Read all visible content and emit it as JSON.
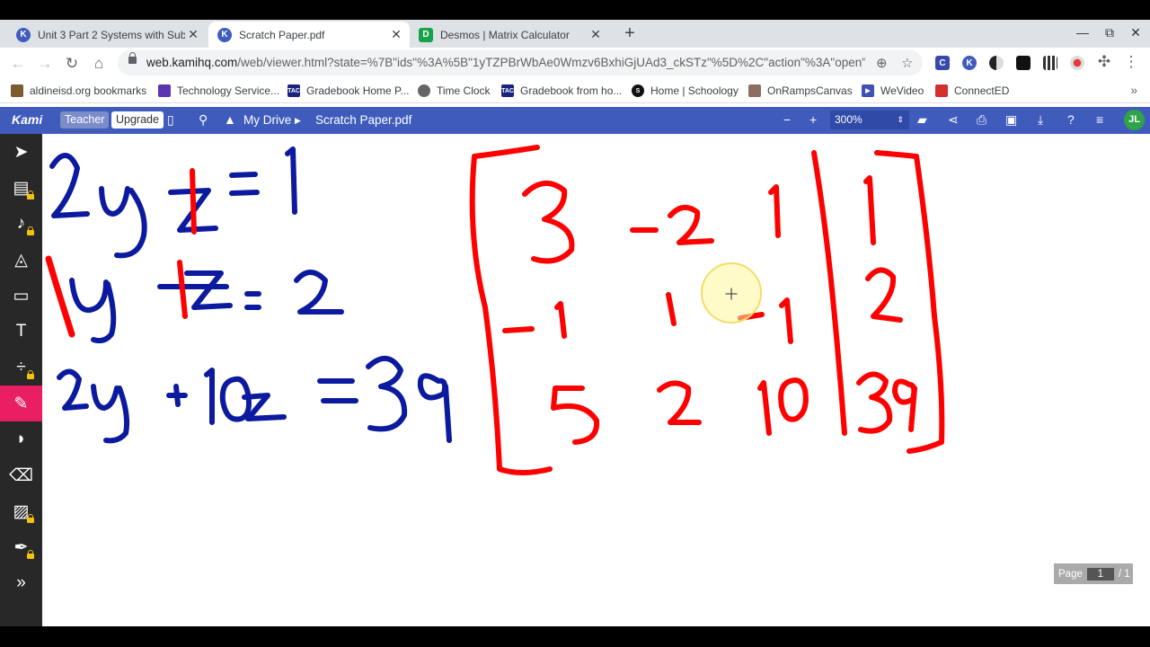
{
  "browser": {
    "tabs": [
      {
        "title": "Unit 3 Part 2 Systems with Subs",
        "favicon": "K",
        "active": false
      },
      {
        "title": "Scratch Paper.pdf",
        "favicon": "K",
        "active": true
      },
      {
        "title": "Desmos | Matrix Calculator",
        "favicon": "D",
        "active": false
      }
    ],
    "url_host": "web.kamihq.com",
    "url_rest": "/web/viewer.html?state=%7B\"ids\"%3A%5B\"1yTZPBrWbAe0Wmzv6BxhiGjUAd3_ckSTz\"%5D%2C\"action\"%3A\"open\"%2C\"...",
    "extensions": [
      "C",
      "K"
    ]
  },
  "bookmarks": [
    "aldineisd.org bookmarks",
    "Technology Service...",
    "Gradebook Home P...",
    "Time Clock",
    "Gradebook from ho...",
    "Home | Schoology",
    "OnRampsCanvas",
    "WeVideo",
    "ConnectED"
  ],
  "bookmark_badges": {
    "tac": "TAC",
    "schoology": "S"
  },
  "kami": {
    "logo": "Kami",
    "teacher_label": "Teacher",
    "upgrade_label": "Upgrade",
    "drive_label": "My Drive",
    "file_name": "Scratch Paper.pdf",
    "zoom": "300%",
    "avatar_initials": "JL"
  },
  "tools": [
    "select",
    "dictionary",
    "text-to-speech",
    "highlighter",
    "comment",
    "text",
    "equation",
    "freehand-drawing",
    "shapes",
    "eraser",
    "image",
    "signature",
    "expand"
  ],
  "tool_glyphs": {
    "text": "T",
    "expand": "»"
  },
  "ink_colors": {
    "blue": "#0b1a9e",
    "red": "#ff0000"
  },
  "handwriting": {
    "equations": [
      "2y +z = 1",
      "1y +z = 2",
      "2y + 10z = 39"
    ],
    "matrix": [
      [
        "3",
        "-2",
        "1",
        "1"
      ],
      [
        "-1",
        "1",
        "1",
        "2"
      ],
      [
        "5",
        "2",
        "10",
        "39"
      ]
    ]
  },
  "page_indicator": {
    "label": "Page",
    "current": "1",
    "total": "/ 1"
  }
}
